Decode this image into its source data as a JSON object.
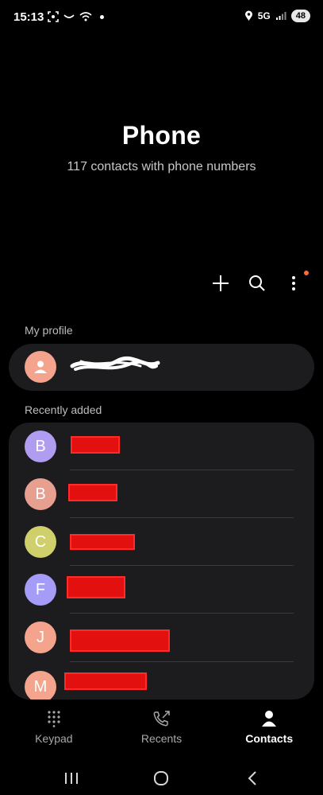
{
  "status_bar": {
    "time": "15:13",
    "network": "5G",
    "battery": "48"
  },
  "header": {
    "title": "Phone",
    "subtitle": "117 contacts with phone numbers"
  },
  "toolbar": {
    "icons": [
      "plus-icon",
      "search-icon",
      "more-vertical-icon"
    ],
    "notification_dot_color": "#ff6a3a"
  },
  "my_profile": {
    "section_label": "My profile",
    "name": "",
    "avatar_color": "#f4a48c"
  },
  "recently_added": {
    "section_label": "Recently added",
    "contacts": [
      {
        "initial": "B",
        "name": "",
        "avatar_color": "#b09cf0"
      },
      {
        "initial": "B",
        "name": "",
        "avatar_color": "#e7a090"
      },
      {
        "initial": "C",
        "name": "",
        "avatar_color": "#cfcf6c"
      },
      {
        "initial": "F",
        "name": "",
        "avatar_color": "#a49cf6"
      },
      {
        "initial": "J",
        "name": "",
        "avatar_color": "#f4a48c"
      },
      {
        "initial": "M",
        "name": "",
        "avatar_color": "#f4a48c"
      }
    ]
  },
  "bottom_nav": {
    "items": [
      {
        "label": "Keypad",
        "icon": "keypad-icon",
        "active": false
      },
      {
        "label": "Recents",
        "icon": "recents-icon",
        "active": false
      },
      {
        "label": "Contacts",
        "icon": "contacts-icon",
        "active": true
      }
    ]
  },
  "colors": {
    "background": "#000000",
    "card": "#1c1c1e",
    "redaction": "#e31010"
  }
}
